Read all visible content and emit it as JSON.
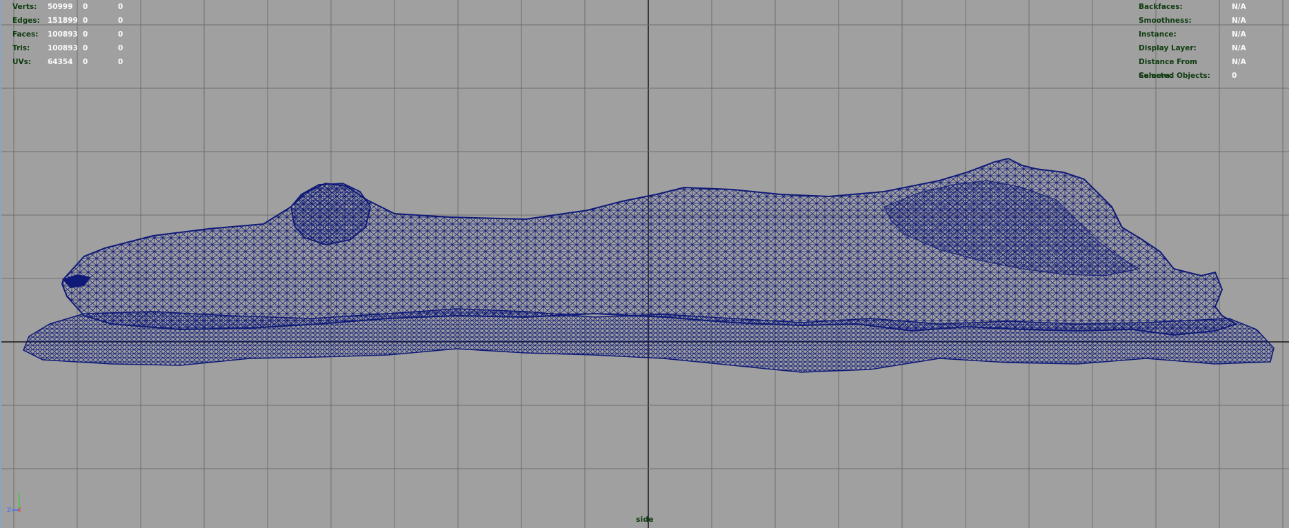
{
  "hud_left": {
    "rows": [
      {
        "label": "Verts:",
        "v1": "50999",
        "v2": "0",
        "v3": "0"
      },
      {
        "label": "Edges:",
        "v1": "151899",
        "v2": "0",
        "v3": "0"
      },
      {
        "label": "Faces:",
        "v1": "100893",
        "v2": "0",
        "v3": "0"
      },
      {
        "label": "Tris:",
        "v1": "100893",
        "v2": "0",
        "v3": "0"
      },
      {
        "label": "UVs:",
        "v1": "64354",
        "v2": "0",
        "v3": "0"
      }
    ]
  },
  "hud_right": {
    "rows": [
      {
        "label": "Backfaces:",
        "value": "N/A"
      },
      {
        "label": "Smoothness:",
        "value": "N/A"
      },
      {
        "label": "Instance:",
        "value": "N/A"
      },
      {
        "label": "Display Layer:",
        "value": "N/A"
      },
      {
        "label": "Distance From Camera:",
        "value": "N/A"
      },
      {
        "label": "Selected Objects:",
        "value": "0"
      }
    ]
  },
  "camera_label": "side",
  "axis_gizmo": {
    "z": "Z",
    "y": "Y",
    "x": "X"
  },
  "colors": {
    "background": "#a0a0a0",
    "grid": "#6e6e6e",
    "axis_lines": "#141414",
    "mesh_wire": "#0f1a78",
    "hud_label": "#0e3b0e",
    "hud_value": "#fafafa"
  }
}
